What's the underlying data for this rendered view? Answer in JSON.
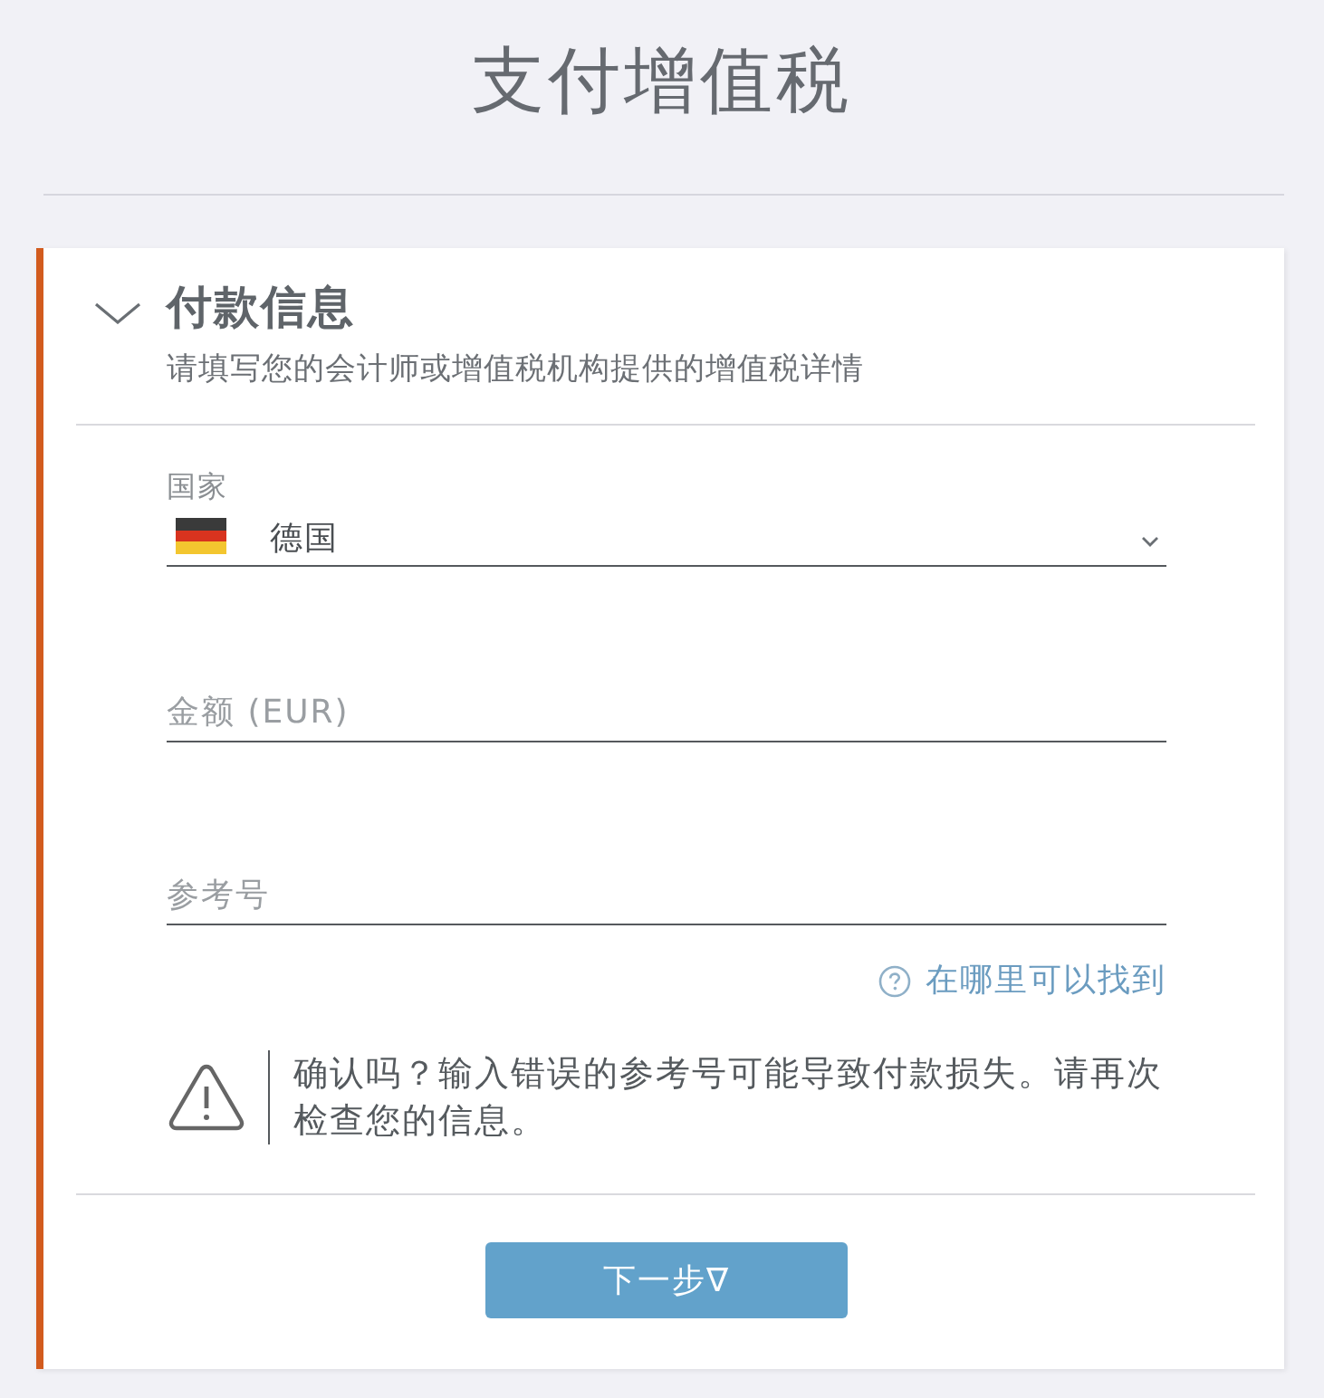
{
  "page": {
    "title": "支付增值税"
  },
  "section": {
    "title": "付款信息",
    "subtitle": "请填写您的会计师或增值税机构提供的增值税详情",
    "expanded": true,
    "fields": [
      {
        "kind": "select",
        "label": "国家",
        "value": "德国"
      },
      {
        "kind": "text",
        "placeholder": "金额 (EUR)"
      },
      {
        "kind": "text",
        "placeholder": "参考号"
      }
    ],
    "help_link": "在哪里可以找到",
    "warning": "确认吗？输入错误的参考号可能导致付款损失。请再次检查您的信息。"
  },
  "buttons": [
    {
      "label": "下一步∇"
    }
  ]
}
